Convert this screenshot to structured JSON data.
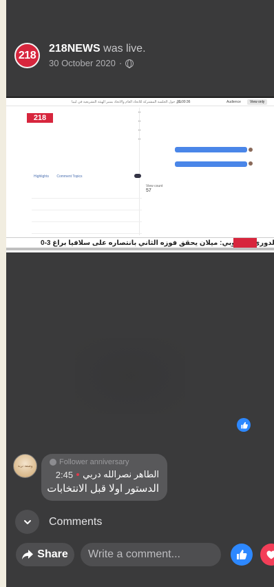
{
  "post": {
    "page_name": "218NEWS",
    "status": "was live.",
    "date": "30 October 2020",
    "separator": "·",
    "avatar_text": "218",
    "audience_icon": "globe-icon"
  },
  "video": {
    "logo_text": "218",
    "topbar_title": "بيان حول الجلسة المشتركة للاتحاد العام والاتحاد بمنبر الهيئة التشريعية في ليبيا",
    "topbar_time": "00:00:36",
    "topbar_mid": "Audience",
    "topbar_button": "View only",
    "ticker_text": "الدوري الأوروبي: ميلان يحقق فوزه الثاني بانتصاره على سلافيا براغ 3-0",
    "tabs": [
      "Highlights",
      "Comment Topics"
    ],
    "stats_label": "View count",
    "stats_value": "57"
  },
  "comment": {
    "badge": "Follower anniversary",
    "author": "الطاهر نصرالله دربي",
    "time": "2:45",
    "text": "الدستور اولا قبل الانتخابات",
    "avatar_text": "وصفة تربة"
  },
  "comments_toggle": {
    "label": "Comments"
  },
  "actions": {
    "share_label": "Share",
    "compose_placeholder": "Write a comment..."
  },
  "colors": {
    "background": "#3a3a3b",
    "accent_blue": "#2d88ff",
    "love_red": "#f33e58",
    "brand_red": "#d7263d"
  }
}
